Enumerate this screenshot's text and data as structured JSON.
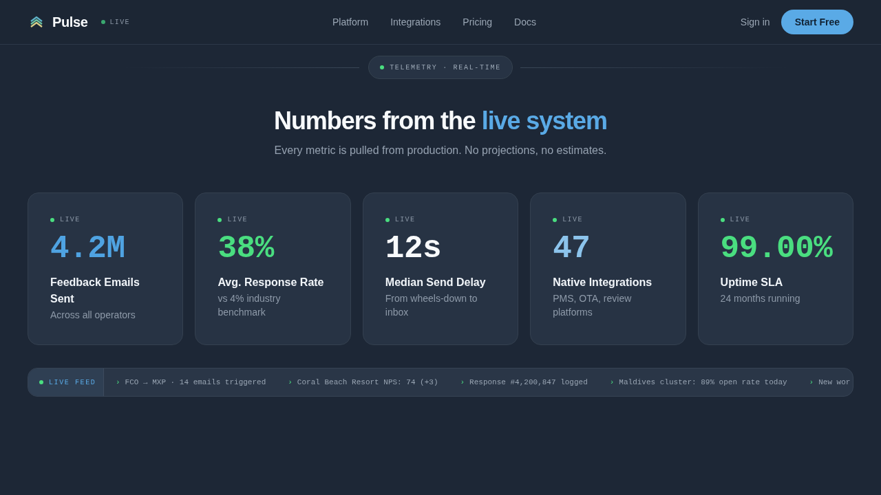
{
  "header": {
    "logo": "Pulse",
    "status": "LIVE",
    "nav": [
      {
        "label": "Platform"
      },
      {
        "label": "Integrations"
      },
      {
        "label": "Pricing"
      },
      {
        "label": "Docs"
      }
    ],
    "sign_in": "Sign in",
    "cta": "Start Free"
  },
  "hero": {
    "eyebrow": "TELEMETRY · REAL-TIME",
    "title": "Numbers from the",
    "title_highlight": "live system",
    "subtitle": "Every metric is pulled from production. No projections, no estimates."
  },
  "stats": [
    {
      "status": "LIVE",
      "value": "4.2M",
      "color": "#4fa3e2",
      "title": "Feedback Emails Sent",
      "description": "Across all operators"
    },
    {
      "status": "LIVE",
      "value": "38%",
      "color": "#4ade80",
      "title": "Avg. Response Rate",
      "description": "vs 4% industry benchmark"
    },
    {
      "status": "LIVE",
      "value": "12s",
      "color": "#f8fafc",
      "title": "Median Send Delay",
      "description": "From wheels-down to inbox"
    },
    {
      "status": "LIVE",
      "value": "47",
      "color": "#8cc4ec",
      "title": "Native Integrations",
      "description": "PMS, OTA, review platforms"
    },
    {
      "status": "LIVE",
      "value": "99.00%",
      "color": "#4ade80",
      "title": "Uptime SLA",
      "description": "24 months running"
    }
  ],
  "feed": {
    "label": "LIVE FEED",
    "items": [
      {
        "marker": "›",
        "text": "FCO → MXP · 14 emails triggered"
      },
      {
        "marker": "›",
        "text": "Coral Beach Resort NPS: 74 (+3)"
      },
      {
        "marker": "›",
        "text": "Response #4,200,847 logged"
      },
      {
        "marker": "›",
        "text": "Maldives cluster: 89% open rate today"
      },
      {
        "marker": "›",
        "text": "New wor"
      }
    ]
  }
}
